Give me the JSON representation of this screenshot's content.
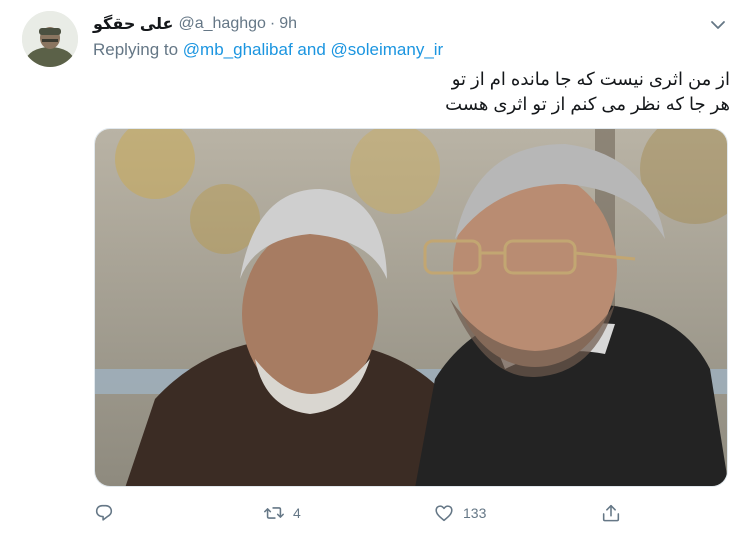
{
  "tweet": {
    "display_name": "علی حقگو",
    "handle": "@a_haghgo",
    "separator": "·",
    "time": "9h",
    "replying_prefix": "Replying to",
    "mention_1": "@mb_ghalibaf",
    "conjunction": "and",
    "mention_2": "@soleimany_ir",
    "text_line_1": "از من اثری نیست که جا مانده ام از تو",
    "text_line_2": "هر جا که نظر می کنم از تو اثری هست",
    "retweet_count": "4",
    "like_count": "133"
  },
  "colors": {
    "link": "#1b95e0",
    "muted": "#657786",
    "text": "#14171a"
  },
  "icons": {
    "caret": "chevron-down-icon",
    "reply": "reply-icon",
    "retweet": "retweet-icon",
    "like": "heart-icon",
    "share": "share-icon"
  }
}
